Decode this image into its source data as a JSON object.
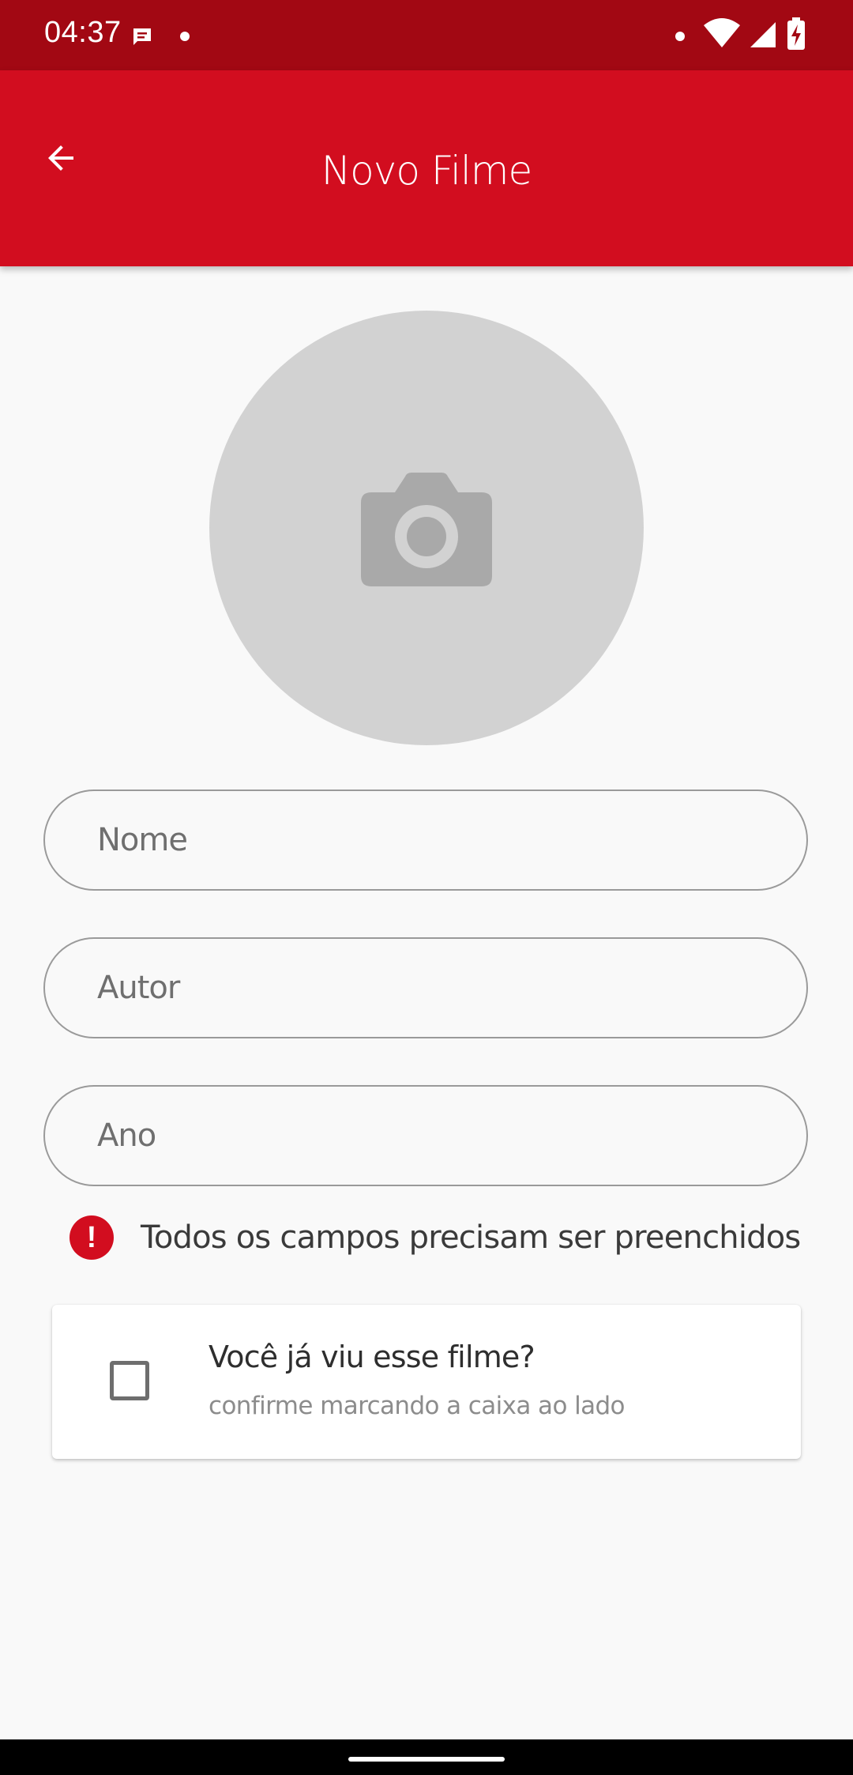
{
  "status_bar": {
    "time": "04:37"
  },
  "app_bar": {
    "title": "Novo Filme",
    "back_icon": "arrow-back-icon"
  },
  "photo": {
    "icon": "camera-icon"
  },
  "form": {
    "nome_placeholder": "Nome",
    "autor_placeholder": "Autor",
    "ano_placeholder": "Ano",
    "error_text": "Todos os campos precisam ser preenchidos",
    "error_icon_glyph": "!"
  },
  "seen_card": {
    "title": "Você já viu esse filme?",
    "subtitle": "confirme marcando a caixa ao lado",
    "checked": false
  },
  "colors": {
    "status_bar": "#a20813",
    "app_bar": "#d20d1f",
    "error": "#d20d1f",
    "background": "#f9f9f9"
  }
}
